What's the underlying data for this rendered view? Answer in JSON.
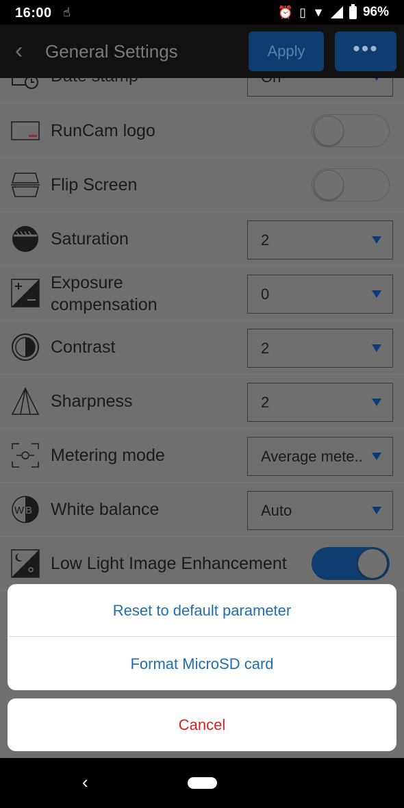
{
  "status_bar": {
    "time": "16:00",
    "battery_percent": "96%",
    "icons": [
      "touch-icon",
      "alarm-icon",
      "vibrate-icon",
      "wifi-icon",
      "signal-icon",
      "battery-icon"
    ]
  },
  "app_bar": {
    "title": "General Settings",
    "apply_label": "Apply",
    "more_label": "•••"
  },
  "settings": [
    {
      "label": "Date stamp",
      "control": "select",
      "value": "On",
      "icon": "date-stamp-icon"
    },
    {
      "label": "RunCam logo",
      "control": "toggle",
      "on": false,
      "icon": "logo-icon"
    },
    {
      "label": "Flip Screen",
      "control": "toggle",
      "on": false,
      "icon": "flip-screen-icon"
    },
    {
      "label": "Saturation",
      "control": "select",
      "value": "2",
      "icon": "saturation-icon"
    },
    {
      "label_line1": "Exposure",
      "label_line2": "compensation",
      "control": "select",
      "value": "0",
      "icon": "exposure-icon"
    },
    {
      "label": "Contrast",
      "control": "select",
      "value": "2",
      "icon": "contrast-icon"
    },
    {
      "label": "Sharpness",
      "control": "select",
      "value": "2",
      "icon": "sharpness-icon"
    },
    {
      "label": "Metering mode",
      "control": "select",
      "value": "Average mete..",
      "icon": "metering-icon"
    },
    {
      "label": "White balance",
      "control": "select",
      "value": "Auto",
      "icon": "white-balance-icon"
    },
    {
      "label": "Low Light Image Enhancement",
      "control": "toggle",
      "on": true,
      "icon": "low-light-icon"
    }
  ],
  "action_sheet": {
    "reset_label": "Reset to default parameter",
    "format_label": "Format MicroSD card",
    "cancel_label": "Cancel"
  },
  "colors": {
    "accent": "#1f6fb2",
    "danger": "#d81e1e",
    "app_button": "#0f3d70"
  }
}
